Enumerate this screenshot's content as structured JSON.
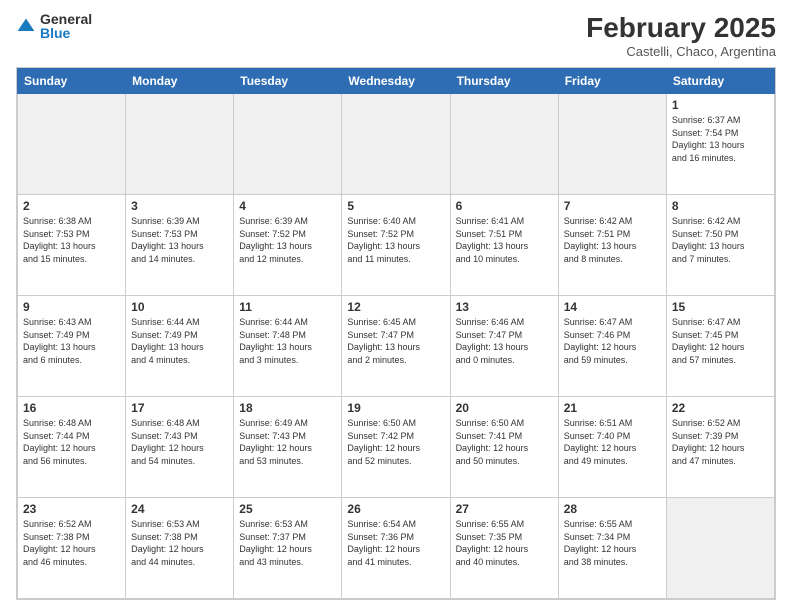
{
  "logo": {
    "general": "General",
    "blue": "Blue"
  },
  "title": "February 2025",
  "location": "Castelli, Chaco, Argentina",
  "headers": [
    "Sunday",
    "Monday",
    "Tuesday",
    "Wednesday",
    "Thursday",
    "Friday",
    "Saturday"
  ],
  "weeks": [
    [
      {
        "day": "",
        "info": ""
      },
      {
        "day": "",
        "info": ""
      },
      {
        "day": "",
        "info": ""
      },
      {
        "day": "",
        "info": ""
      },
      {
        "day": "",
        "info": ""
      },
      {
        "day": "",
        "info": ""
      },
      {
        "day": "1",
        "info": "Sunrise: 6:37 AM\nSunset: 7:54 PM\nDaylight: 13 hours\nand 16 minutes."
      }
    ],
    [
      {
        "day": "2",
        "info": "Sunrise: 6:38 AM\nSunset: 7:53 PM\nDaylight: 13 hours\nand 15 minutes."
      },
      {
        "day": "3",
        "info": "Sunrise: 6:39 AM\nSunset: 7:53 PM\nDaylight: 13 hours\nand 14 minutes."
      },
      {
        "day": "4",
        "info": "Sunrise: 6:39 AM\nSunset: 7:52 PM\nDaylight: 13 hours\nand 12 minutes."
      },
      {
        "day": "5",
        "info": "Sunrise: 6:40 AM\nSunset: 7:52 PM\nDaylight: 13 hours\nand 11 minutes."
      },
      {
        "day": "6",
        "info": "Sunrise: 6:41 AM\nSunset: 7:51 PM\nDaylight: 13 hours\nand 10 minutes."
      },
      {
        "day": "7",
        "info": "Sunrise: 6:42 AM\nSunset: 7:51 PM\nDaylight: 13 hours\nand 8 minutes."
      },
      {
        "day": "8",
        "info": "Sunrise: 6:42 AM\nSunset: 7:50 PM\nDaylight: 13 hours\nand 7 minutes."
      }
    ],
    [
      {
        "day": "9",
        "info": "Sunrise: 6:43 AM\nSunset: 7:49 PM\nDaylight: 13 hours\nand 6 minutes."
      },
      {
        "day": "10",
        "info": "Sunrise: 6:44 AM\nSunset: 7:49 PM\nDaylight: 13 hours\nand 4 minutes."
      },
      {
        "day": "11",
        "info": "Sunrise: 6:44 AM\nSunset: 7:48 PM\nDaylight: 13 hours\nand 3 minutes."
      },
      {
        "day": "12",
        "info": "Sunrise: 6:45 AM\nSunset: 7:47 PM\nDaylight: 13 hours\nand 2 minutes."
      },
      {
        "day": "13",
        "info": "Sunrise: 6:46 AM\nSunset: 7:47 PM\nDaylight: 13 hours\nand 0 minutes."
      },
      {
        "day": "14",
        "info": "Sunrise: 6:47 AM\nSunset: 7:46 PM\nDaylight: 12 hours\nand 59 minutes."
      },
      {
        "day": "15",
        "info": "Sunrise: 6:47 AM\nSunset: 7:45 PM\nDaylight: 12 hours\nand 57 minutes."
      }
    ],
    [
      {
        "day": "16",
        "info": "Sunrise: 6:48 AM\nSunset: 7:44 PM\nDaylight: 12 hours\nand 56 minutes."
      },
      {
        "day": "17",
        "info": "Sunrise: 6:48 AM\nSunset: 7:43 PM\nDaylight: 12 hours\nand 54 minutes."
      },
      {
        "day": "18",
        "info": "Sunrise: 6:49 AM\nSunset: 7:43 PM\nDaylight: 12 hours\nand 53 minutes."
      },
      {
        "day": "19",
        "info": "Sunrise: 6:50 AM\nSunset: 7:42 PM\nDaylight: 12 hours\nand 52 minutes."
      },
      {
        "day": "20",
        "info": "Sunrise: 6:50 AM\nSunset: 7:41 PM\nDaylight: 12 hours\nand 50 minutes."
      },
      {
        "day": "21",
        "info": "Sunrise: 6:51 AM\nSunset: 7:40 PM\nDaylight: 12 hours\nand 49 minutes."
      },
      {
        "day": "22",
        "info": "Sunrise: 6:52 AM\nSunset: 7:39 PM\nDaylight: 12 hours\nand 47 minutes."
      }
    ],
    [
      {
        "day": "23",
        "info": "Sunrise: 6:52 AM\nSunset: 7:38 PM\nDaylight: 12 hours\nand 46 minutes."
      },
      {
        "day": "24",
        "info": "Sunrise: 6:53 AM\nSunset: 7:38 PM\nDaylight: 12 hours\nand 44 minutes."
      },
      {
        "day": "25",
        "info": "Sunrise: 6:53 AM\nSunset: 7:37 PM\nDaylight: 12 hours\nand 43 minutes."
      },
      {
        "day": "26",
        "info": "Sunrise: 6:54 AM\nSunset: 7:36 PM\nDaylight: 12 hours\nand 41 minutes."
      },
      {
        "day": "27",
        "info": "Sunrise: 6:55 AM\nSunset: 7:35 PM\nDaylight: 12 hours\nand 40 minutes."
      },
      {
        "day": "28",
        "info": "Sunrise: 6:55 AM\nSunset: 7:34 PM\nDaylight: 12 hours\nand 38 minutes."
      },
      {
        "day": "",
        "info": ""
      }
    ]
  ]
}
